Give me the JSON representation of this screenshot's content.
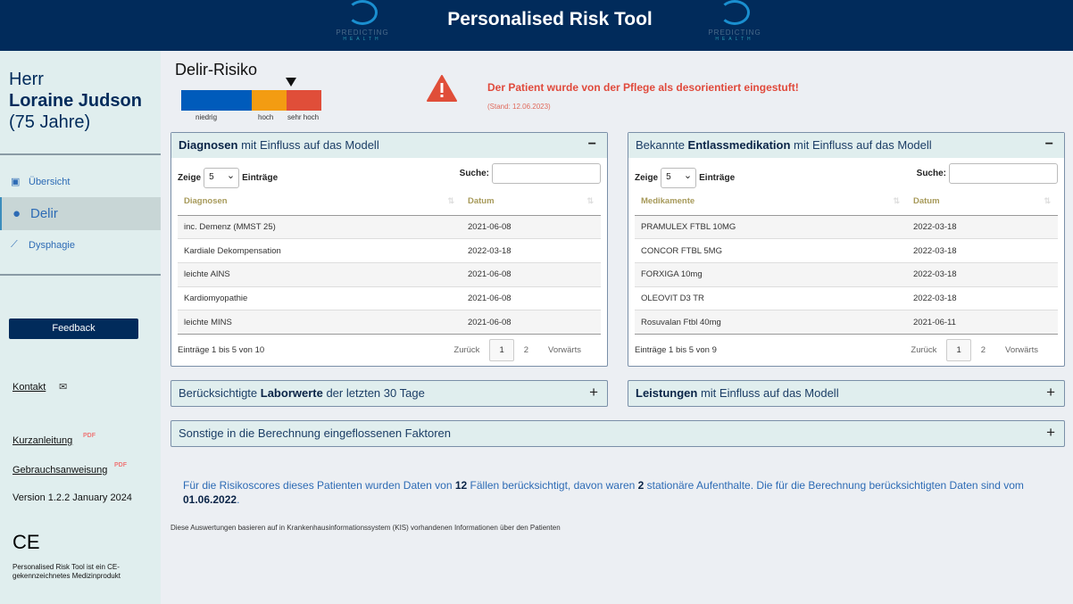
{
  "header": {
    "title": "Personalised Risk Tool",
    "logo_text": "PREDICTING",
    "logo_sub": "HEALTH"
  },
  "patient": {
    "salutation": "Herr",
    "name": "Loraine Judson",
    "age": "(75 Jahre)"
  },
  "nav": [
    {
      "label": "Übersicht",
      "icon": "newspaper-icon"
    },
    {
      "label": "Delir",
      "icon": "brain-icon",
      "active": true
    },
    {
      "label": "Dysphagie",
      "icon": "spoon-icon"
    }
  ],
  "sidebar": {
    "feedback": "Feedback",
    "kontakt": "Kontakt",
    "kurzanleitung": "Kurzanleitung",
    "gebrauchsanweisung": "Gebrauchsanweisung",
    "version": "Version 1.2.2 January 2024",
    "ce_mark": "CE",
    "ce_text": "Personalised Risk Tool ist ein CE-gekennzeichnetes Medizinprodukt",
    "pdf": "PDF"
  },
  "risk": {
    "title": "Delir-Risiko",
    "levels": [
      "niedrig",
      "hoch",
      "sehr hoch"
    ],
    "colors": [
      "#005bbb",
      "#f39c12",
      "#e04e39"
    ],
    "current": "sehr hoch"
  },
  "alert": {
    "text": "Der Patient wurde von der Pflege als desorientiert eingestuft!",
    "date": "(Stand: 12.06.2023)"
  },
  "diagnosen": {
    "title_bold": "Diagnosen",
    "title_rest": " mit Einfluss auf das Modell",
    "toggle": "−",
    "show": "Zeige",
    "show_value": "5",
    "entries": "Einträge",
    "search": "Suche:",
    "columns": [
      "Diagnosen",
      "Datum"
    ],
    "rows": [
      [
        "inc. Demenz (MMST 25)",
        "2021-06-08"
      ],
      [
        "Kardiale Dekompensation",
        "2022-03-18"
      ],
      [
        "leichte AINS",
        "2021-06-08"
      ],
      [
        "Kardiomyopathie",
        "2021-06-08"
      ],
      [
        "leichte MINS",
        "2021-06-08"
      ]
    ],
    "info": "Einträge 1 bis 5 von 10",
    "prev": "Zurück",
    "pages": [
      "1",
      "2"
    ],
    "next": "Vorwärts"
  },
  "medikation": {
    "title_pre": "Bekannte ",
    "title_bold": "Entlassmedikation",
    "title_rest": " mit Einfluss auf das Modell",
    "toggle": "−",
    "show": "Zeige",
    "show_value": "5",
    "entries": "Einträge",
    "search": "Suche:",
    "columns": [
      "Medikamente",
      "Datum"
    ],
    "rows": [
      [
        "PRAMULEX FTBL 10MG",
        "2022-03-18"
      ],
      [
        "CONCOR FTBL 5MG",
        "2022-03-18"
      ],
      [
        "FORXIGA 10mg",
        "2022-03-18"
      ],
      [
        "OLEOVIT D3 TR",
        "2022-03-18"
      ],
      [
        "Rosuvalan Ftbl 40mg",
        "2021-06-11"
      ]
    ],
    "info": "Einträge 1 bis 5 von 9",
    "prev": "Zurück",
    "pages": [
      "1",
      "2"
    ],
    "next": "Vorwärts"
  },
  "labor": {
    "pre": "Berücksichtigte ",
    "bold": "Laborwerte",
    "rest": " der letzten 30 Tage",
    "toggle": "+"
  },
  "leistungen": {
    "bold": "Leistungen",
    "rest": " mit Einfluss auf das Modell",
    "toggle": "+"
  },
  "sonstige": {
    "text": "Sonstige in die Berechnung eingeflossenen Faktoren",
    "toggle": "+"
  },
  "summary": {
    "p1": "Für die Risikoscores dieses Patienten wurden Daten von ",
    "n1": "12",
    "p2": " Fällen berücksichtigt, davon waren ",
    "n2": "2",
    "p3": " stationäre Aufenthalte. Die für die Berechnung berücksichtigten Daten sind vom ",
    "date": "01.06.2022",
    "p4": "."
  },
  "note": "Diese Auswertungen basieren auf in Krankenhausinformationssystem (KIS) vorhandenen Informationen über den Patienten"
}
